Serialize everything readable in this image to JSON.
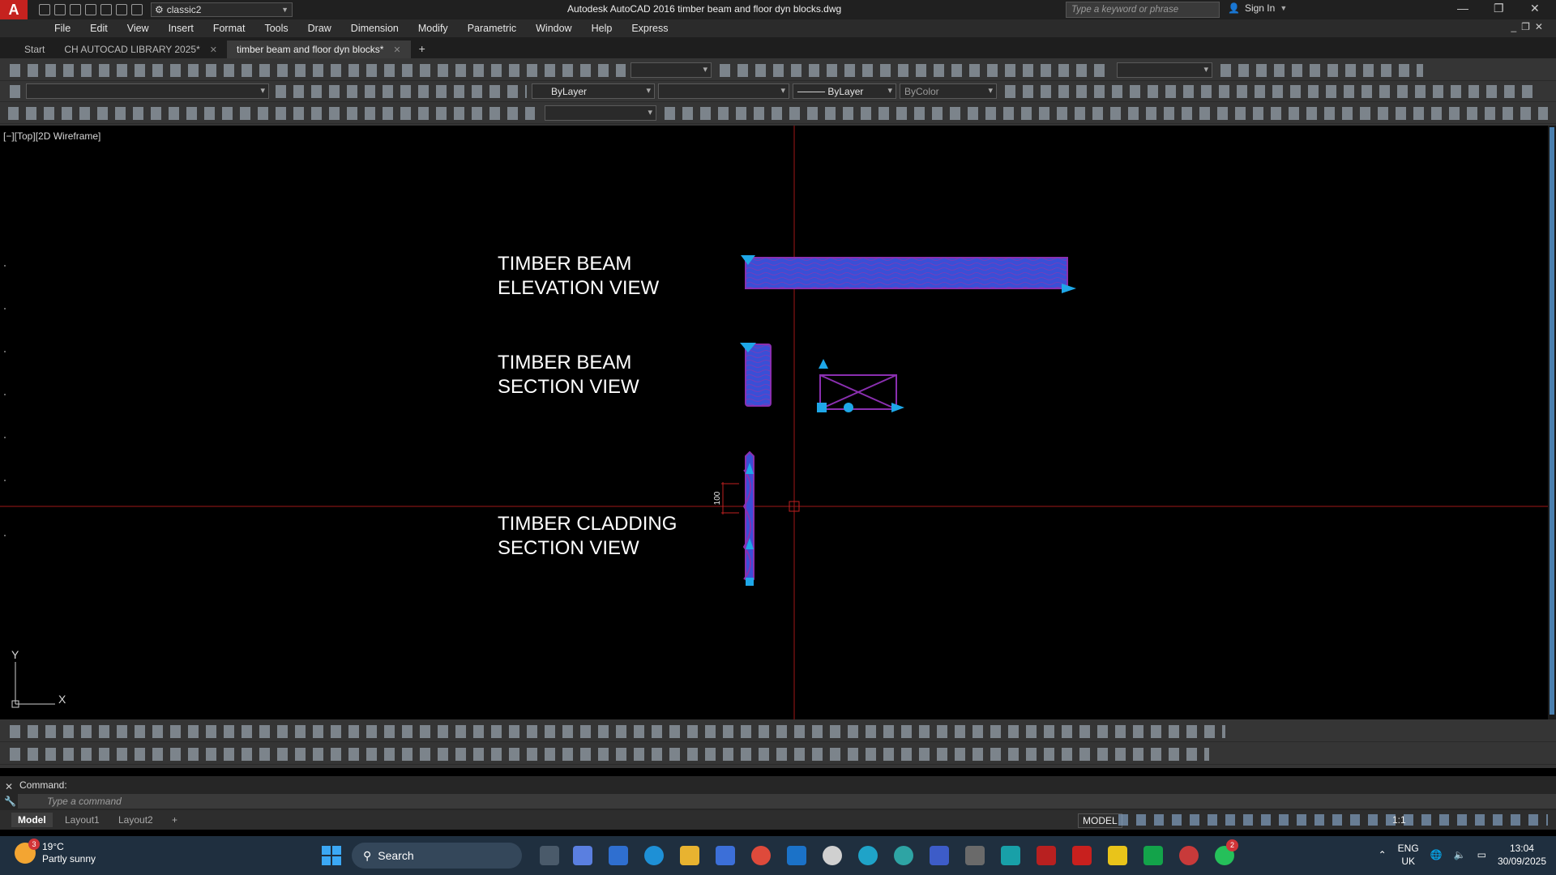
{
  "titlebar": {
    "logo": "A",
    "workspace": "classic2",
    "title": "Autodesk AutoCAD 2016    timber beam and floor dyn blocks.dwg",
    "search_placeholder": "Type a keyword or phrase",
    "sign_in": "Sign In"
  },
  "menu": [
    "File",
    "Edit",
    "View",
    "Insert",
    "Format",
    "Tools",
    "Draw",
    "Dimension",
    "Modify",
    "Parametric",
    "Window",
    "Help",
    "Express"
  ],
  "file_tabs": [
    {
      "label": "Start"
    },
    {
      "label": "CH AUTOCAD LIBRARY 2025*"
    },
    {
      "label": "timber beam and floor dyn blocks*"
    }
  ],
  "properties": {
    "layer_combo": "ByLayer",
    "linetype_combo": "ByLayer",
    "color_combo": "ByColor"
  },
  "viewport": {
    "label": "[−][Top][2D Wireframe]",
    "labels": [
      {
        "line1": "TIMBER BEAM",
        "line2": "ELEVATION VIEW"
      },
      {
        "line1": "TIMBER BEAM",
        "line2": "SECTION VIEW"
      },
      {
        "line1": "TIMBER CLADDING",
        "line2": "SECTION VIEW"
      }
    ],
    "dimension_text": "100",
    "ucs_x": "X",
    "ucs_y": "Y"
  },
  "command": {
    "history": "Command:",
    "placeholder": "Type a command"
  },
  "layout_tabs": [
    "Model",
    "Layout1",
    "Layout2"
  ],
  "status": {
    "model": "MODEL",
    "scale": "1:1"
  },
  "taskbar": {
    "temperature": "19°C",
    "weather": "Partly sunny",
    "weather_badge": "3",
    "search": "Search",
    "lang1": "ENG",
    "lang2": "UK",
    "time": "13:04",
    "date": "30/09/2025",
    "whatsapp_badge": "2"
  },
  "colors": {
    "crosshair": "#a01818",
    "beam_fill": "#3a4fd6",
    "beam_outline": "#8a2fb0",
    "grip": "#1ea7e8",
    "accent": "#4a7fae"
  }
}
